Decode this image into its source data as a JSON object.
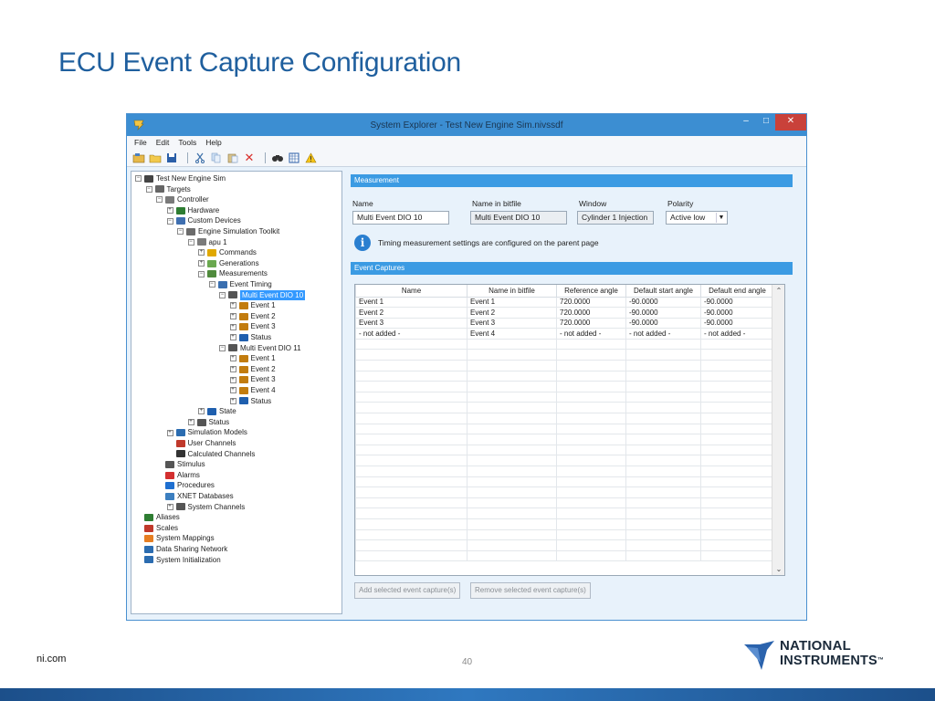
{
  "slide": {
    "title": "ECU Event Capture Configuration",
    "footer_left": "ni.com",
    "page_number": "40",
    "logo_line1": "NATIONAL",
    "logo_line2": "INSTRUMENTS",
    "logo_tm": "™"
  },
  "window": {
    "title": "System Explorer - Test New Engine Sim.nivssdf",
    "min_glyph": "‒",
    "max_glyph": "□",
    "close_glyph": "✕"
  },
  "menu": [
    "File",
    "Edit",
    "Tools",
    "Help"
  ],
  "toolbar": {
    "icons": [
      "open-project-icon",
      "open-folder-icon",
      "save-icon",
      "cut-icon",
      "copy-icon",
      "paste-icon",
      "delete-icon",
      "find-icon",
      "grid-icon",
      "warning-icon"
    ],
    "delete_glyph": "✕",
    "find_glyph": "🔭",
    "warning_glyph": "⚠"
  },
  "tree": [
    {
      "label": "Test New Engine Sim",
      "level": 0,
      "exp": "-",
      "icon": "project-icon",
      "color": "#444444"
    },
    {
      "label": "Targets",
      "level": 1,
      "exp": "-",
      "icon": "targets-icon",
      "color": "#666666"
    },
    {
      "label": "Controller",
      "level": 2,
      "exp": "-",
      "icon": "controller-icon",
      "color": "#7a7a7a"
    },
    {
      "label": "Hardware",
      "level": 3,
      "exp": "+",
      "icon": "hardware-icon",
      "color": "#2e7d32"
    },
    {
      "label": "Custom Devices",
      "level": 3,
      "exp": "-",
      "icon": "custom-devices-icon",
      "color": "#3f6fb0"
    },
    {
      "label": "Engine Simulation Toolkit",
      "level": 4,
      "exp": "-",
      "icon": "engine-toolkit-icon",
      "color": "#6b6b6b"
    },
    {
      "label": "apu 1",
      "level": 5,
      "exp": "-",
      "icon": "apu-icon",
      "color": "#7b7b7b"
    },
    {
      "label": "Commands",
      "level": 6,
      "exp": "+",
      "icon": "commands-icon",
      "color": "#e0a800"
    },
    {
      "label": "Generations",
      "level": 6,
      "exp": "+",
      "icon": "generations-icon",
      "color": "#6aa84f"
    },
    {
      "label": "Measurements",
      "level": 6,
      "exp": "-",
      "icon": "measurements-icon",
      "color": "#4f8a3c"
    },
    {
      "label": "Event Timing",
      "level": 7,
      "exp": "-",
      "icon": "event-timing-icon",
      "color": "#3a6fb0"
    },
    {
      "label": "Multi Event DIO 10",
      "level": 8,
      "exp": "-",
      "icon": "multi-event-icon",
      "color": "#555555",
      "selected": true
    },
    {
      "label": "Event 1",
      "level": 9,
      "exp": "+",
      "icon": "event-icon",
      "color": "#c27c0e"
    },
    {
      "label": "Event 2",
      "level": 9,
      "exp": "+",
      "icon": "event-icon",
      "color": "#c27c0e"
    },
    {
      "label": "Event 3",
      "level": 9,
      "exp": "+",
      "icon": "event-icon",
      "color": "#c27c0e"
    },
    {
      "label": "Status",
      "level": 9,
      "exp": "+",
      "icon": "status-info-icon",
      "color": "#1f5fae"
    },
    {
      "label": "Multi Event DIO 11",
      "level": 8,
      "exp": "-",
      "icon": "multi-event-icon",
      "color": "#555555"
    },
    {
      "label": "Event 1",
      "level": 9,
      "exp": "+",
      "icon": "event-icon",
      "color": "#c27c0e"
    },
    {
      "label": "Event 2",
      "level": 9,
      "exp": "+",
      "icon": "event-icon",
      "color": "#c27c0e"
    },
    {
      "label": "Event 3",
      "level": 9,
      "exp": "+",
      "icon": "event-icon",
      "color": "#c27c0e"
    },
    {
      "label": "Event 4",
      "level": 9,
      "exp": "+",
      "icon": "event-icon",
      "color": "#c27c0e"
    },
    {
      "label": "Status",
      "level": 9,
      "exp": "+",
      "icon": "status-info-icon",
      "color": "#1f5fae"
    },
    {
      "label": "State",
      "level": 6,
      "exp": "+",
      "icon": "state-info-icon",
      "color": "#1f5fae"
    },
    {
      "label": "Status",
      "level": 5,
      "exp": "+",
      "icon": "status-icon",
      "color": "#555555"
    },
    {
      "label": "Simulation Models",
      "level": 3,
      "exp": "+",
      "icon": "simulation-models-icon",
      "color": "#2b6cb0"
    },
    {
      "label": "User Channels",
      "level": 3,
      "exp": "",
      "icon": "user-channels-icon",
      "color": "#c0392b"
    },
    {
      "label": "Calculated Channels",
      "level": 3,
      "exp": "",
      "icon": "calculated-channels-icon",
      "color": "#333333"
    },
    {
      "label": "Stimulus",
      "level": 2,
      "exp": "",
      "icon": "stimulus-icon",
      "color": "#555555"
    },
    {
      "label": "Alarms",
      "level": 2,
      "exp": "",
      "icon": "alarms-icon",
      "color": "#d32f2f"
    },
    {
      "label": "Procedures",
      "level": 2,
      "exp": "",
      "icon": "procedures-icon",
      "color": "#1e6fd0"
    },
    {
      "label": "XNET Databases",
      "level": 2,
      "exp": "",
      "icon": "xnet-databases-icon",
      "color": "#3c7fc0"
    },
    {
      "label": "System Channels",
      "level": 3,
      "exp": "+",
      "icon": "system-channels-icon",
      "color": "#555555"
    },
    {
      "label": "Aliases",
      "level": 0,
      "exp": "",
      "icon": "aliases-icon",
      "color": "#2e7d32"
    },
    {
      "label": "Scales",
      "level": 0,
      "exp": "",
      "icon": "scales-icon",
      "color": "#c0392b"
    },
    {
      "label": "System Mappings",
      "level": 0,
      "exp": "",
      "icon": "system-mappings-icon",
      "color": "#e67e22"
    },
    {
      "label": "Data Sharing Network",
      "level": 0,
      "exp": "",
      "icon": "data-sharing-network-icon",
      "color": "#2b6cb0"
    },
    {
      "label": "System Initialization",
      "level": 0,
      "exp": "",
      "icon": "system-initialization-icon",
      "color": "#2b6cb0"
    }
  ],
  "measurement": {
    "header": "Measurement",
    "name_label": "Name",
    "name_value": "Multi Event DIO 10",
    "bitfile_label": "Name in bitfile",
    "bitfile_value": "Multi Event DIO 10",
    "window_label": "Window",
    "window_value": "Cylinder 1 Injection",
    "polarity_label": "Polarity",
    "polarity_value": "Active low",
    "info_text": "Timing measurement settings are configured on the parent page"
  },
  "event_captures": {
    "header": "Event Captures",
    "columns": [
      "Name",
      "Name in bitfile",
      "Reference angle",
      "Default start angle",
      "Default end angle"
    ],
    "rows": [
      [
        "Event 1",
        "Event 1",
        "720.0000",
        "-90.0000",
        "-90.0000"
      ],
      [
        "Event 2",
        "Event 2",
        "720.0000",
        "-90.0000",
        "-90.0000"
      ],
      [
        "Event 3",
        "Event 3",
        "720.0000",
        "-90.0000",
        "-90.0000"
      ],
      [
        "- not added -",
        "Event 4",
        "- not added -",
        "- not added -",
        "- not added -"
      ]
    ],
    "add_button": "Add selected event capture(s)",
    "remove_button": "Remove selected event capture(s)"
  }
}
